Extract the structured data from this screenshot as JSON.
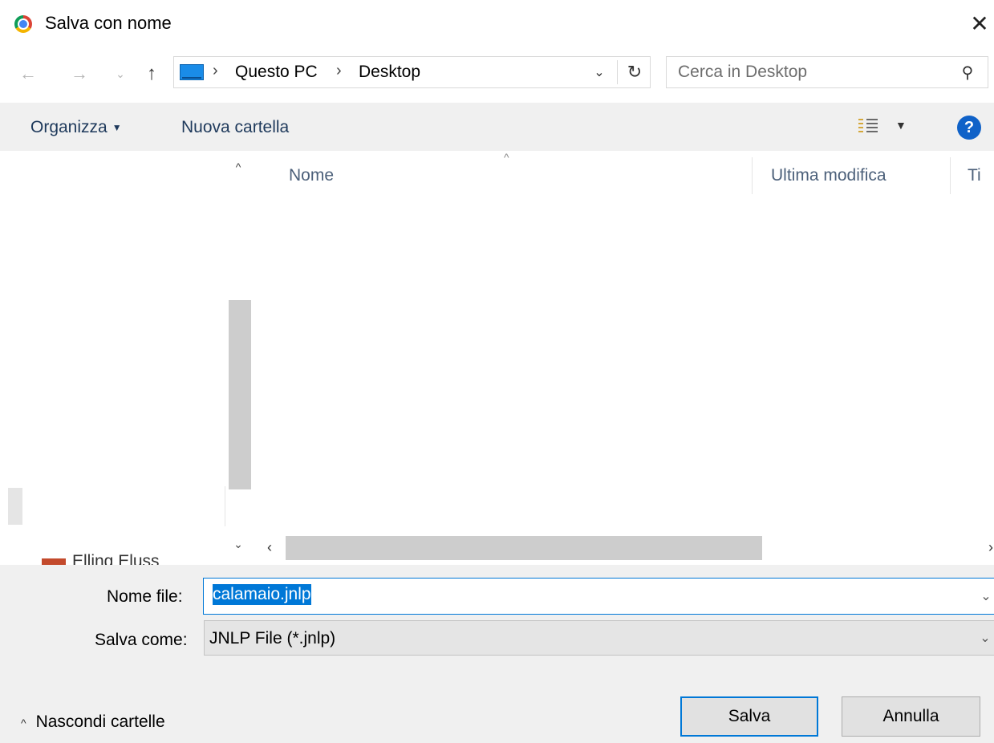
{
  "window": {
    "title": "Salva con nome",
    "close_glyph": "✕",
    "app_icon": "chrome-icon"
  },
  "navigation": {
    "back_glyph": "←",
    "forward_glyph": "→",
    "recent_glyph": "⌄",
    "up_glyph": "↑"
  },
  "address_bar": {
    "icon": "this-pc-icon",
    "separator": "›",
    "breadcrumbs": [
      "Questo PC",
      "Desktop"
    ],
    "dropdown_glyph": "⌄",
    "refresh_glyph": "↻"
  },
  "search": {
    "placeholder": "Cerca in Desktop",
    "value": "",
    "icon_glyph": "⚲"
  },
  "toolbar": {
    "organize_label": "Organizza",
    "organize_caret": "▼",
    "new_folder_label": "Nuova cartella",
    "view_caret": "▼",
    "help_glyph": "?"
  },
  "file_list": {
    "sort_indicator": "^",
    "columns": [
      "Nome",
      "Ultima modifica",
      "Ti"
    ],
    "rows": [],
    "scroll_left": "‹",
    "scroll_right": "›"
  },
  "nav_pane": {
    "scroll_up": "^",
    "scroll_down": "⌄",
    "partial_item_text": "Elling Eluss"
  },
  "save_form": {
    "filename_label": "Nome file:",
    "filename_value": "calamaio.jnlp",
    "filetype_label": "Salva come:",
    "filetype_value": "JNLP File (*.jnlp)",
    "dropdown_glyph": "⌄"
  },
  "footer": {
    "hide_folders_chevron": "^",
    "hide_folders_label": "Nascondi cartelle",
    "save_label": "Salva",
    "cancel_label": "Annulla"
  },
  "colors": {
    "accent": "#0078d7",
    "toolbar_bg": "#f0f0f0",
    "help_icon_bg": "#1062c8",
    "column_header_text": "#4c607a"
  }
}
